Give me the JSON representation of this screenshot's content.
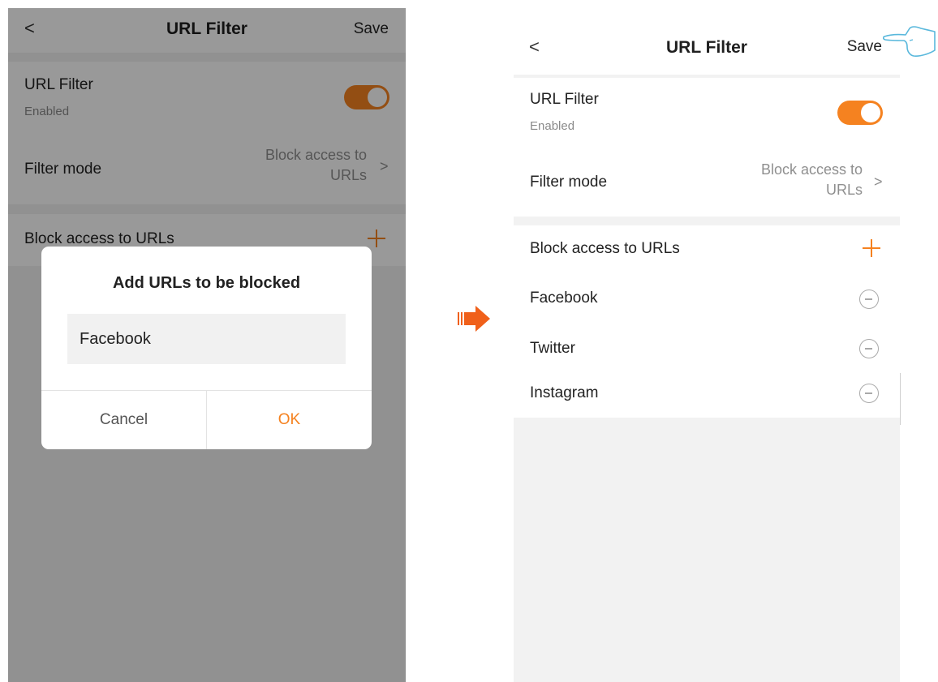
{
  "colors": {
    "accent": "#f58220",
    "background": "#f2f2f2",
    "card": "#ffffff",
    "muted_text": "#8f8f8f"
  },
  "icons": {
    "back": "chevron-left-icon",
    "chevron": "chevron-right-icon",
    "add": "plus-icon",
    "remove": "minus-circle-icon",
    "arrow": "arrow-right-icon",
    "hand": "pointing-hand-icon"
  },
  "left_screen": {
    "nav": {
      "back": "<",
      "title": "URL Filter",
      "save": "Save"
    },
    "url_filter": {
      "label": "URL Filter",
      "status": "Enabled",
      "enabled": true
    },
    "filter_mode": {
      "label": "Filter mode",
      "value_line1": "Block access to",
      "value_line2": "URLs",
      "chevron": ">"
    },
    "block_section": {
      "label": "Block access to URLs"
    },
    "dialog": {
      "title": "Add URLs to be blocked",
      "input_value": "Facebook",
      "cancel": "Cancel",
      "ok": "OK"
    }
  },
  "right_screen": {
    "nav": {
      "back": "<",
      "title": "URL Filter",
      "save": "Save"
    },
    "url_filter": {
      "label": "URL Filter",
      "status": "Enabled",
      "enabled": true
    },
    "filter_mode": {
      "label": "Filter mode",
      "value_line1": "Block access to",
      "value_line2": "URLs",
      "chevron": ">"
    },
    "block_section": {
      "label": "Block access to URLs"
    },
    "blocked_urls": [
      "Facebook",
      "Twitter",
      "Instagram"
    ]
  }
}
